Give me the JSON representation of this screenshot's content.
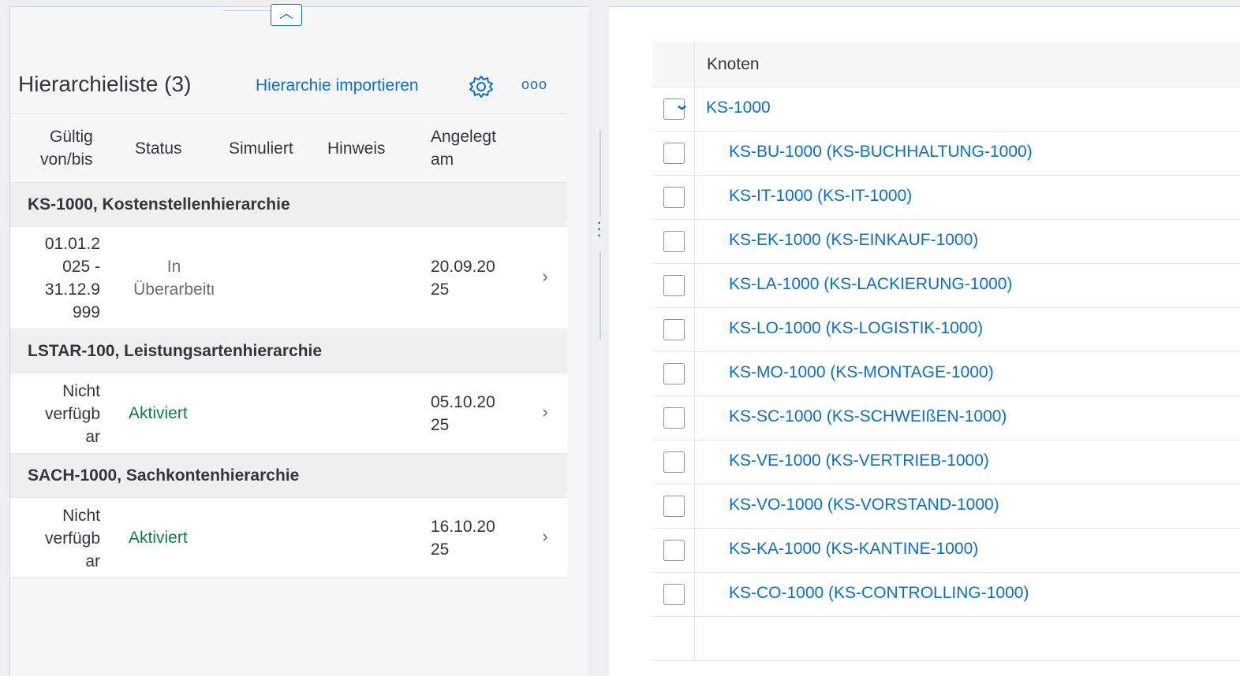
{
  "left_panel": {
    "collapse_icon": "chevron-up-icon",
    "title": "Hierarchieliste (3)",
    "import_label": "Hierarchie importieren",
    "settings_icon": "gear-icon",
    "more_icon": "overflow-icon",
    "more_glyph": "ooo",
    "columns": {
      "valid_line1": "Gültig",
      "valid_line2": "von/bis",
      "status": "Status",
      "simulated": "Simuliert",
      "note": "Hinweis",
      "created_line1": "Angelegt",
      "created_line2": "am"
    },
    "groups": [
      {
        "title": "KS-1000, Kostenstellenhierarchie",
        "valid": [
          "01.01.2",
          "025 -",
          "31.12.9",
          "999"
        ],
        "status": [
          "In",
          "Überarbeitι"
        ],
        "created": [
          "20.09.20",
          "25"
        ]
      },
      {
        "title": "LSTAR-100, Leistungsartenhierarchie",
        "valid": [
          "Nicht",
          "verfügb",
          "ar"
        ],
        "status": [
          "Aktiviert"
        ],
        "created": [
          "05.10.20",
          "25"
        ]
      },
      {
        "title": "SACH-1000, Sachkontenhierarchie",
        "valid": [
          "Nicht",
          "verfügb",
          "ar"
        ],
        "status": [
          "Aktiviert"
        ],
        "created": [
          "16.10.20",
          "25"
        ]
      }
    ],
    "nav_glyph": "›"
  },
  "right_panel": {
    "column_header": "Knoten",
    "expander_icon": "chevron-down-icon",
    "root": "KS-1000",
    "children": [
      "KS-BU-1000 (KS-BUCHHALTUNG-1000)",
      "KS-IT-1000 (KS-IT-1000)",
      "KS-EK-1000 (KS-EINKAUF-1000)",
      "KS-LA-1000 (KS-LACKIERUNG-1000)",
      "KS-LO-1000 (KS-LOGISTIK-1000)",
      "KS-MO-1000 (KS-MONTAGE-1000)",
      "KS-SC-1000 (KS-SCHWEIßEN-1000)",
      "KS-VE-1000 (KS-VERTRIEB-1000)",
      "KS-VO-1000 (KS-VORSTAND-1000)",
      "KS-KA-1000 (KS-KANTINE-1000)",
      "KS-CO-1000 (KS-CONTROLLING-1000)"
    ]
  },
  "colors": {
    "link": "#0a6ed1",
    "positive": "#107e3e",
    "text": "#32363a"
  }
}
